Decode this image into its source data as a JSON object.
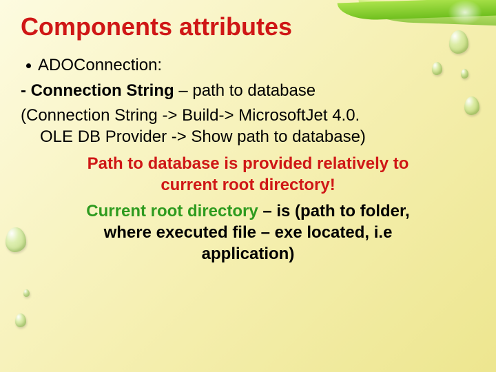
{
  "title": "Components attributes",
  "bullet1": "ADOConnection:",
  "line2_dash": "- ",
  "line2_cs": "Connection String",
  "line2_rest": " – path to database",
  "paren_line1": "(Connection String -> Build-> MicrosoftJet 4.0.",
  "paren_line2": "OLE DB Provider -> Show path to database)",
  "red1": "Path to database is provided relatively to",
  "red2": "current root directory!",
  "green_crd": "Current root directory",
  "green_rest1": " – is (path to folder,",
  "green_rest2": "where executed file – exe located, i.e",
  "green_rest3": "application)"
}
